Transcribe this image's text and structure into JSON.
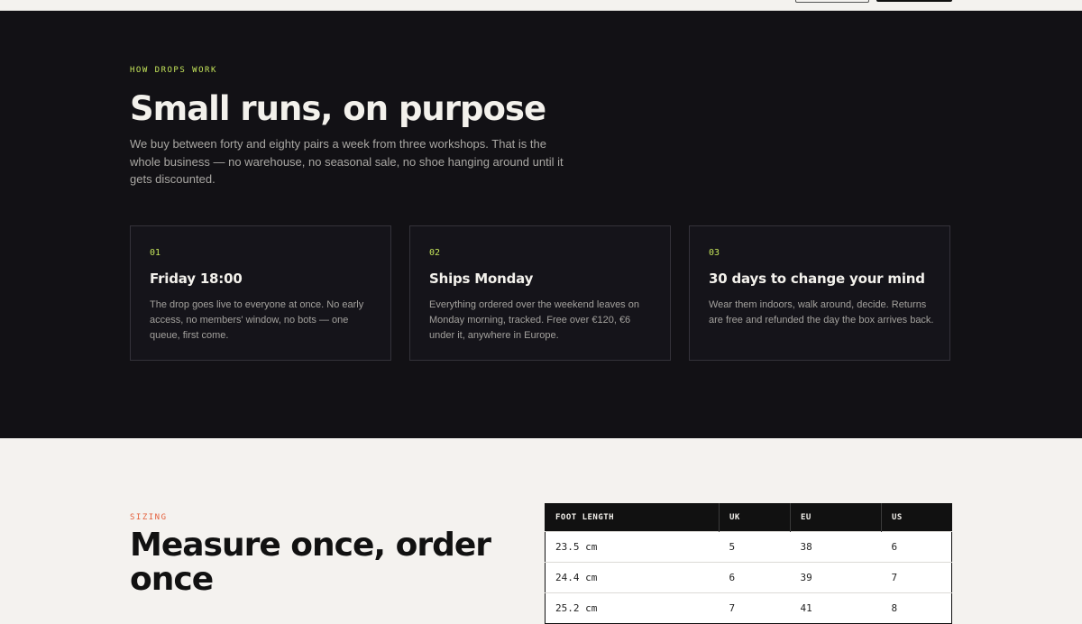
{
  "how_drops": {
    "eyebrow": "HOW DROPS WORK",
    "heading": "Small runs, on purpose",
    "lede": "We buy between forty and eighty pairs a week from three workshops. That is the whole business — no warehouse, no seasonal sale, no shoe hanging around until it gets discounted.",
    "cards": [
      {
        "number": "01",
        "title": "Friday 18:00",
        "body": "The drop goes live to everyone at once. No early access, no members' window, no bots — one queue, first come."
      },
      {
        "number": "02",
        "title": "Ships Monday",
        "body": "Everything ordered over the weekend leaves on Monday morning, tracked. Free over €120, €6 under it, anywhere in Europe."
      },
      {
        "number": "03",
        "title": "30 days to change your mind",
        "body": "Wear them indoors, walk around, decide. Returns are free and refunded the day the box arrives back."
      }
    ]
  },
  "sizing": {
    "eyebrow": "SIZING",
    "heading": "Measure once, order once",
    "table": {
      "headers": [
        "FOOT LENGTH",
        "UK",
        "EU",
        "US"
      ],
      "rows": [
        [
          "23.5 cm",
          "5",
          "38",
          "6"
        ],
        [
          "24.4 cm",
          "6",
          "39",
          "7"
        ],
        [
          "25.2 cm",
          "7",
          "41",
          "8"
        ]
      ]
    }
  },
  "colors": {
    "accent_lime": "#c4e45a",
    "accent_orange": "#e4603c",
    "dark_bg": "#121115"
  }
}
